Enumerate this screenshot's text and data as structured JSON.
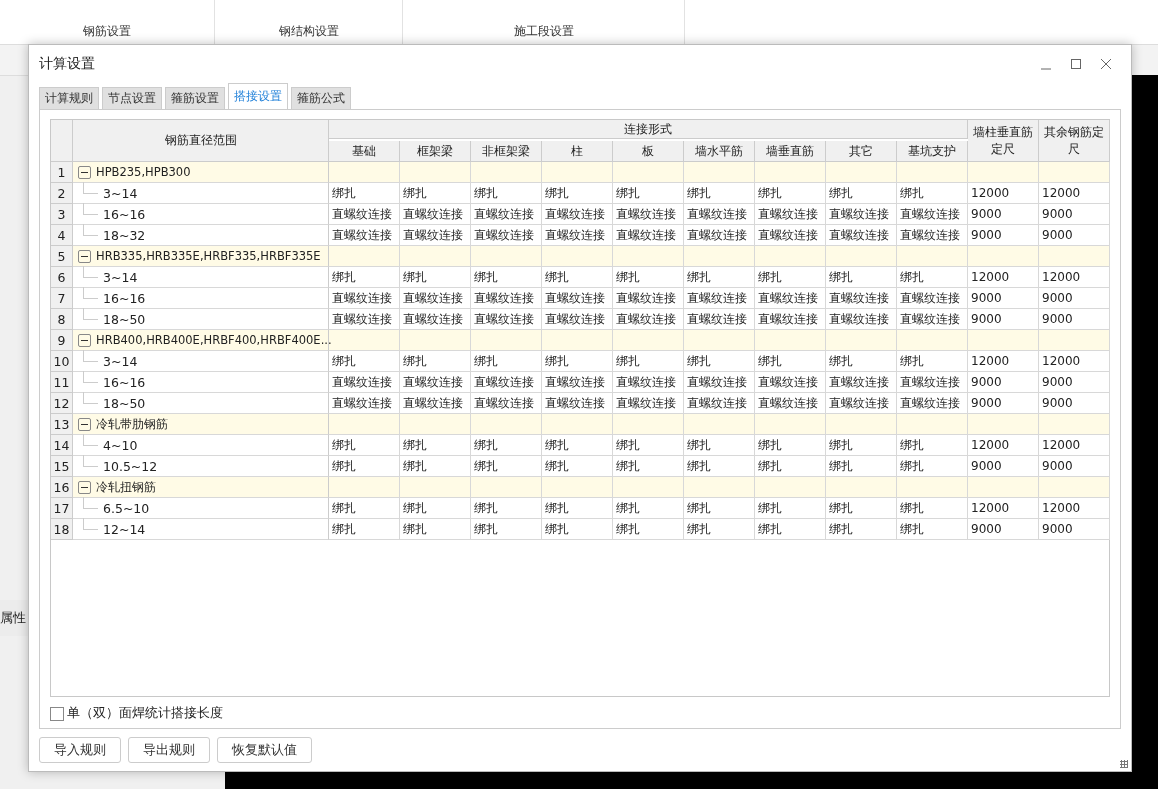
{
  "background": {
    "ribbon_groups": [
      "钢筋设置",
      "钢结构设置",
      "施工段设置"
    ],
    "side_label": "属性"
  },
  "dialog": {
    "title": "计算设置",
    "tabs": [
      {
        "label": "计算规则",
        "selected": false
      },
      {
        "label": "节点设置",
        "selected": false
      },
      {
        "label": "箍筋设置",
        "selected": false
      },
      {
        "label": "搭接设置",
        "selected": true
      },
      {
        "label": "箍筋公式",
        "selected": false
      }
    ],
    "table": {
      "range_header": "钢筋直径范围",
      "group_header": "连接形式",
      "columns": [
        "基础",
        "框架梁",
        "非框架梁",
        "柱",
        "板",
        "墙水平筋",
        "墙垂直筋",
        "其它",
        "基坑支护"
      ],
      "length_columns": [
        "墙柱垂直筋定尺",
        "其余钢筋定尺"
      ],
      "rows": [
        {
          "number": "1",
          "label": "HPB235,HPB300",
          "expanded": true,
          "children": [
            {
              "number": "2",
              "range": "3~14",
              "cells": [
                "绑扎",
                "绑扎",
                "绑扎",
                "绑扎",
                "绑扎",
                "绑扎",
                "绑扎",
                "绑扎",
                "绑扎"
              ],
              "lengths": [
                "12000",
                "12000"
              ]
            },
            {
              "number": "3",
              "range": "16~16",
              "cells": [
                "直螺纹连接",
                "直螺纹连接",
                "直螺纹连接",
                "直螺纹连接",
                "直螺纹连接",
                "直螺纹连接",
                "直螺纹连接",
                "直螺纹连接",
                "直螺纹连接"
              ],
              "lengths": [
                "9000",
                "9000"
              ]
            },
            {
              "number": "4",
              "range": "18~32",
              "cells": [
                "直螺纹连接",
                "直螺纹连接",
                "直螺纹连接",
                "直螺纹连接",
                "直螺纹连接",
                "直螺纹连接",
                "直螺纹连接",
                "直螺纹连接",
                "直螺纹连接"
              ],
              "lengths": [
                "9000",
                "9000"
              ]
            }
          ]
        },
        {
          "number": "5",
          "label": "HRB335,HRB335E,HRBF335,HRBF335E",
          "expanded": true,
          "children": [
            {
              "number": "6",
              "range": "3~14",
              "cells": [
                "绑扎",
                "绑扎",
                "绑扎",
                "绑扎",
                "绑扎",
                "绑扎",
                "绑扎",
                "绑扎",
                "绑扎"
              ],
              "lengths": [
                "12000",
                "12000"
              ]
            },
            {
              "number": "7",
              "range": "16~16",
              "cells": [
                "直螺纹连接",
                "直螺纹连接",
                "直螺纹连接",
                "直螺纹连接",
                "直螺纹连接",
                "直螺纹连接",
                "直螺纹连接",
                "直螺纹连接",
                "直螺纹连接"
              ],
              "lengths": [
                "9000",
                "9000"
              ]
            },
            {
              "number": "8",
              "range": "18~50",
              "cells": [
                "直螺纹连接",
                "直螺纹连接",
                "直螺纹连接",
                "直螺纹连接",
                "直螺纹连接",
                "直螺纹连接",
                "直螺纹连接",
                "直螺纹连接",
                "直螺纹连接"
              ],
              "lengths": [
                "9000",
                "9000"
              ]
            }
          ]
        },
        {
          "number": "9",
          "label": "HRB400,HRB400E,HRBF400,HRBF400E...",
          "expanded": true,
          "children": [
            {
              "number": "10",
              "range": "3~14",
              "cells": [
                "绑扎",
                "绑扎",
                "绑扎",
                "绑扎",
                "绑扎",
                "绑扎",
                "绑扎",
                "绑扎",
                "绑扎"
              ],
              "lengths": [
                "12000",
                "12000"
              ]
            },
            {
              "number": "11",
              "range": "16~16",
              "cells": [
                "直螺纹连接",
                "直螺纹连接",
                "直螺纹连接",
                "直螺纹连接",
                "直螺纹连接",
                "直螺纹连接",
                "直螺纹连接",
                "直螺纹连接",
                "直螺纹连接"
              ],
              "lengths": [
                "9000",
                "9000"
              ]
            },
            {
              "number": "12",
              "range": "18~50",
              "cells": [
                "直螺纹连接",
                "直螺纹连接",
                "直螺纹连接",
                "直螺纹连接",
                "直螺纹连接",
                "直螺纹连接",
                "直螺纹连接",
                "直螺纹连接",
                "直螺纹连接"
              ],
              "lengths": [
                "9000",
                "9000"
              ]
            }
          ]
        },
        {
          "number": "13",
          "label": "冷轧带肋钢筋",
          "expanded": true,
          "children": [
            {
              "number": "14",
              "range": "4~10",
              "cells": [
                "绑扎",
                "绑扎",
                "绑扎",
                "绑扎",
                "绑扎",
                "绑扎",
                "绑扎",
                "绑扎",
                "绑扎"
              ],
              "lengths": [
                "12000",
                "12000"
              ]
            },
            {
              "number": "15",
              "range": "10.5~12",
              "cells": [
                "绑扎",
                "绑扎",
                "绑扎",
                "绑扎",
                "绑扎",
                "绑扎",
                "绑扎",
                "绑扎",
                "绑扎"
              ],
              "lengths": [
                "9000",
                "9000"
              ]
            }
          ]
        },
        {
          "number": "16",
          "label": "冷轧扭钢筋",
          "expanded": true,
          "children": [
            {
              "number": "17",
              "range": "6.5~10",
              "cells": [
                "绑扎",
                "绑扎",
                "绑扎",
                "绑扎",
                "绑扎",
                "绑扎",
                "绑扎",
                "绑扎",
                "绑扎"
              ],
              "lengths": [
                "12000",
                "12000"
              ]
            },
            {
              "number": "18",
              "range": "12~14",
              "cells": [
                "绑扎",
                "绑扎",
                "绑扎",
                "绑扎",
                "绑扎",
                "绑扎",
                "绑扎",
                "绑扎",
                "绑扎"
              ],
              "lengths": [
                "9000",
                "9000"
              ]
            }
          ]
        }
      ]
    },
    "checkbox": {
      "label": "单（双）面焊统计搭接长度",
      "checked": false
    },
    "buttons": [
      "导入规则",
      "导出规则",
      "恢复默认值"
    ]
  }
}
